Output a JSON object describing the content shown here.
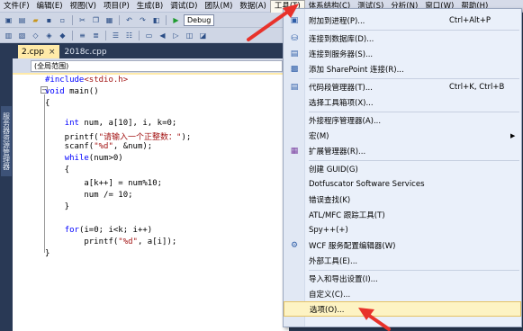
{
  "menubar": {
    "items": [
      {
        "label": "文件(F)"
      },
      {
        "label": "编辑(E)"
      },
      {
        "label": "视图(V)"
      },
      {
        "label": "项目(P)"
      },
      {
        "label": "生成(B)"
      },
      {
        "label": "调试(D)"
      },
      {
        "label": "团队(M)"
      },
      {
        "label": "数据(A)"
      },
      {
        "label": "工具(T)"
      },
      {
        "label": "体系结构(C)"
      },
      {
        "label": "测试(S)"
      },
      {
        "label": "分析(N)"
      },
      {
        "label": "窗口(W)"
      },
      {
        "label": "帮助(H)"
      }
    ]
  },
  "toolbar": {
    "config_combo": "Debug"
  },
  "dock": {
    "label": "服务器资源管理器"
  },
  "tabs": [
    {
      "label": "2.cpp",
      "close": "×"
    },
    {
      "label": "2018c.cpp"
    }
  ],
  "nav": {
    "scope": "(全局范围)"
  },
  "code": {
    "lines": [
      {
        "text": "#include<stdio.h>"
      },
      {
        "text": "void main()"
      },
      {
        "text": "{"
      },
      {
        "text": "    int num, a[10], i, k=0;"
      },
      {
        "text": "    printf(\"请输入一个正整数：\");"
      },
      {
        "text": "    scanf(\"%d\", &num);"
      },
      {
        "text": "    while(num>0)"
      },
      {
        "text": "    {"
      },
      {
        "text": "        a[k++] = num%10;"
      },
      {
        "text": "        num /= 10;"
      },
      {
        "text": "    }"
      },
      {
        "text": ""
      },
      {
        "text": "    for(i=0; i<k; i++)"
      },
      {
        "text": "        printf(\"%d\", a[i]);"
      },
      {
        "text": "}"
      }
    ]
  },
  "tools_menu": {
    "items": [
      {
        "label": "附加到进程(P)...",
        "shortcut": "Ctrl+Alt+P",
        "icon": "attach-icon"
      },
      {
        "label": "连接到数据库(D)...",
        "shortcut": "",
        "icon": "database-icon"
      },
      {
        "label": "连接到服务器(S)...",
        "shortcut": "",
        "icon": "server-icon"
      },
      {
        "label": "添加 SharePoint 连接(R)...",
        "shortcut": "",
        "icon": "sharepoint-icon"
      },
      {
        "label": "代码段管理器(T)...",
        "shortcut": "Ctrl+K, Ctrl+B",
        "icon": "snippet-icon"
      },
      {
        "label": "选择工具箱项(X)...",
        "shortcut": "",
        "icon": ""
      },
      {
        "label": "外接程序管理器(A)...",
        "shortcut": "",
        "icon": ""
      },
      {
        "label": "宏(M)",
        "shortcut": "",
        "icon": "",
        "submenu": "▶"
      },
      {
        "label": "扩展管理器(R)...",
        "shortcut": "",
        "icon": "extension-icon"
      },
      {
        "label": "创建 GUID(G)",
        "shortcut": "",
        "icon": ""
      },
      {
        "label": "Dotfuscator Software Services",
        "shortcut": "",
        "icon": ""
      },
      {
        "label": "错误查找(K)",
        "shortcut": "",
        "icon": ""
      },
      {
        "label": "ATL/MFC 跟踪工具(T)",
        "shortcut": "",
        "icon": ""
      },
      {
        "label": "Spy++(+)",
        "shortcut": "",
        "icon": ""
      },
      {
        "label": "WCF 服务配置编辑器(W)",
        "shortcut": "",
        "icon": "wcf-icon"
      },
      {
        "label": "外部工具(E)...",
        "shortcut": "",
        "icon": ""
      },
      {
        "label": "导入和导出设置(I)...",
        "shortcut": "",
        "icon": ""
      },
      {
        "label": "自定义(C)...",
        "shortcut": "",
        "icon": ""
      },
      {
        "label": "选项(O)...",
        "shortcut": "",
        "icon": ""
      }
    ]
  },
  "colors": {
    "annotation_arrow": "#e8322b",
    "highlight": "#fdf3c3"
  }
}
